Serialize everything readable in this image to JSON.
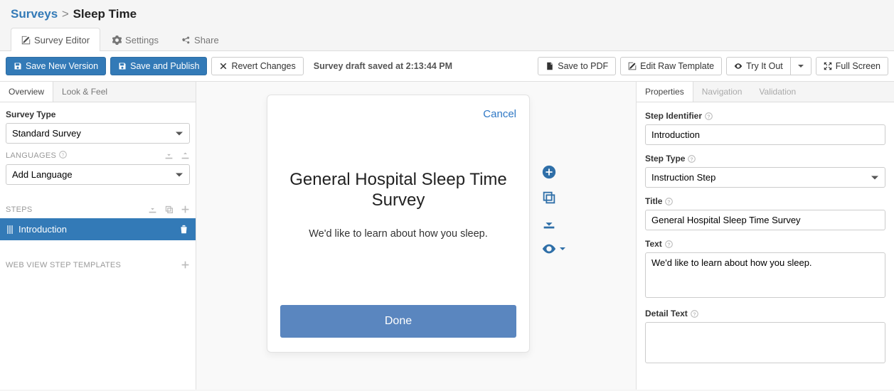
{
  "breadcrumb": {
    "root": "Surveys",
    "sep": ">",
    "current": "Sleep Time"
  },
  "nav_tabs": {
    "editor": "Survey Editor",
    "settings": "Settings",
    "share": "Share"
  },
  "toolbar": {
    "save_new_version": "Save New Version",
    "save_publish": "Save and Publish",
    "revert": "Revert Changes",
    "status": "Survey draft saved at 2:13:44 PM",
    "save_pdf": "Save to PDF",
    "edit_raw": "Edit Raw Template",
    "try_it": "Try It Out",
    "full_screen": "Full Screen"
  },
  "left": {
    "tabs": {
      "overview": "Overview",
      "look": "Look & Feel"
    },
    "survey_type_label": "Survey Type",
    "survey_type_value": "Standard Survey",
    "languages_label": "LANGUAGES",
    "add_language_value": "Add Language",
    "steps_label": "STEPS",
    "step_items": [
      "Introduction"
    ],
    "web_templates_label": "WEB VIEW STEP TEMPLATES"
  },
  "preview": {
    "cancel": "Cancel",
    "title": "General Hospital Sleep Time Survey",
    "text": "We'd like to learn about how you sleep.",
    "done": "Done"
  },
  "right": {
    "tabs": {
      "properties": "Properties",
      "navigation": "Navigation",
      "validation": "Validation"
    },
    "step_identifier_label": "Step Identifier",
    "step_identifier_value": "Introduction",
    "step_type_label": "Step Type",
    "step_type_value": "Instruction Step",
    "title_label": "Title",
    "title_value": "General Hospital Sleep Time Survey",
    "text_label": "Text",
    "text_value": "We'd like to learn about how you sleep.",
    "detail_text_label": "Detail Text",
    "detail_text_value": ""
  }
}
